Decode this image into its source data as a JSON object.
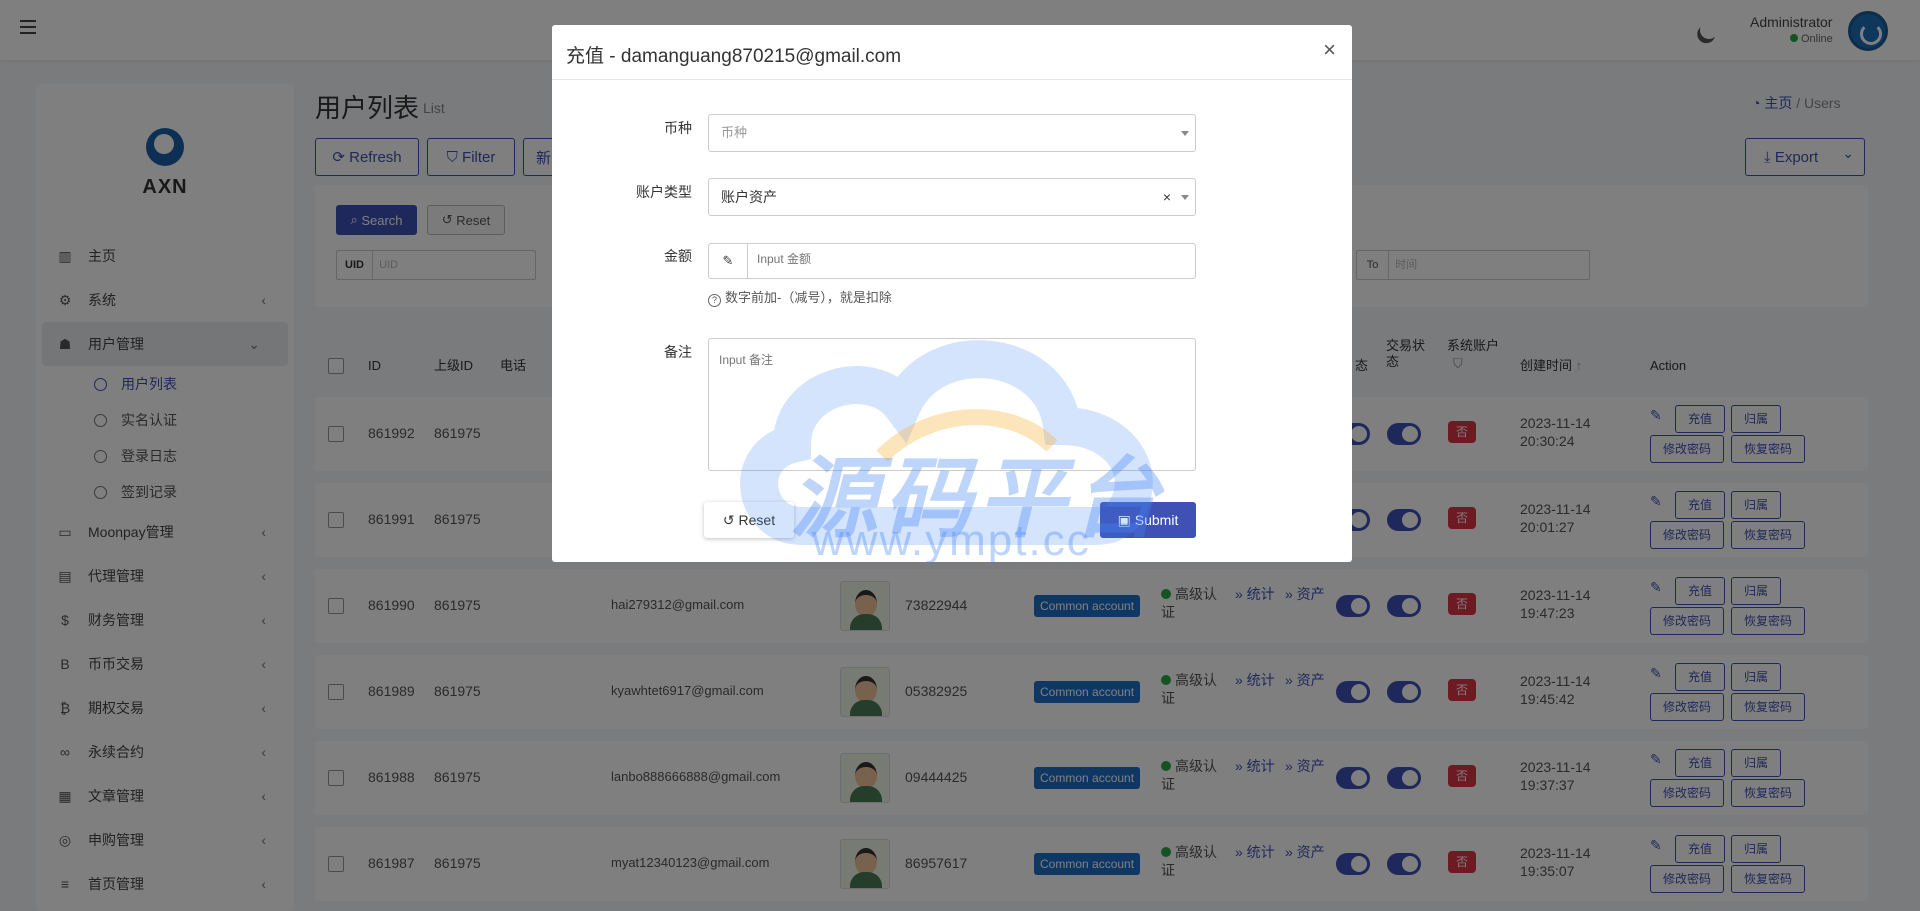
{
  "app": {
    "brand": "AXN",
    "user_name": "Administrator",
    "user_status": "Online"
  },
  "sidebar": {
    "items": [
      {
        "label": "主页",
        "icon": "bar-chart-icon"
      },
      {
        "label": "系统",
        "icon": "gear-icon"
      },
      {
        "label": "用户管理",
        "icon": "users-icon"
      },
      {
        "label": "Moonpay管理",
        "icon": "credit-card-icon"
      },
      {
        "label": "代理管理",
        "icon": "id-card-icon"
      },
      {
        "label": "财务管理",
        "icon": "dollar-icon"
      },
      {
        "label": "币币交易",
        "icon": "bitcoin-b-icon"
      },
      {
        "label": "期权交易",
        "icon": "bitcoin-icon"
      },
      {
        "label": "永续合约",
        "icon": "link-icon"
      },
      {
        "label": "文章管理",
        "icon": "newspaper-icon"
      },
      {
        "label": "申购管理",
        "icon": "life-ring-icon"
      },
      {
        "label": "首页管理",
        "icon": "list-icon"
      }
    ],
    "sub_items": [
      "用户列表",
      "实名认证",
      "登录日志",
      "签到记录"
    ]
  },
  "page": {
    "title": "用户列表",
    "subtitle": "List",
    "breadcrumb_home": "主页",
    "breadcrumb_sep": "/",
    "breadcrumb_current": "Users"
  },
  "toolbar": {
    "refresh": "Refresh",
    "filter": "Filter",
    "new": "新",
    "export": "Export",
    "search": "Search",
    "reset": "Reset"
  },
  "filters": {
    "uid_label": "UID",
    "uid_placeholder": "UID",
    "to_label": "To",
    "to_placeholder": "时间"
  },
  "table": {
    "headers": {
      "id": "ID",
      "parent_id": "上级ID",
      "phone": "电话",
      "status_tail": "态",
      "trade_status": "交易状态",
      "system_account": "系统账户",
      "created": "创建时间",
      "action": "Action"
    },
    "rows": [
      {
        "id": "861992",
        "parent": "861975",
        "email": "",
        "phone": "",
        "created_date": "2023-11-14",
        "created_time": "20:30:24",
        "sys": "否"
      },
      {
        "id": "861991",
        "parent": "861975",
        "email": "",
        "phone": "",
        "created_date": "2023-11-14",
        "created_time": "20:01:27",
        "sys": "否"
      },
      {
        "id": "861990",
        "parent": "861975",
        "email": "hai279312@gmail.com",
        "phone": "73822944",
        "account": "Common account",
        "auth": "高级认证",
        "stats": "» 统计",
        "assets": "» 资产",
        "created_date": "2023-11-14",
        "created_time": "19:47:23",
        "sys": "否"
      },
      {
        "id": "861989",
        "parent": "861975",
        "email": "kyawhtet6917@gmail.com",
        "phone": "05382925",
        "account": "Common account",
        "auth": "高级认证",
        "stats": "» 统计",
        "assets": "» 资产",
        "created_date": "2023-11-14",
        "created_time": "19:45:42",
        "sys": "否"
      },
      {
        "id": "861988",
        "parent": "861975",
        "email": "lanbo888666888@gmail.com",
        "phone": "09444425",
        "account": "Common account",
        "auth": "高级认证",
        "stats": "» 统计",
        "assets": "» 资产",
        "created_date": "2023-11-14",
        "created_time": "19:37:37",
        "sys": "否"
      },
      {
        "id": "861987",
        "parent": "861975",
        "email": "myat12340123@gmail.com",
        "phone": "86957617",
        "account": "Common account",
        "auth": "高级认证",
        "stats": "» 统计",
        "assets": "» 资产",
        "created_date": "2023-11-14",
        "created_time": "19:35:07",
        "sys": "否"
      }
    ],
    "actions": {
      "recharge": "充值",
      "belong": "归属",
      "edit_pwd": "修改密码",
      "restore_pwd": "恢复密码"
    }
  },
  "modal": {
    "title": "充值 - damanguang870215@gmail.com",
    "close": "×",
    "currency_label": "币种",
    "currency_placeholder": "币种",
    "account_type_label": "账户类型",
    "account_type_value": "账户资产",
    "account_type_clear": "×",
    "amount_label": "金额",
    "amount_placeholder": "Input 金额",
    "amount_help": "数字前加-（减号），就是扣除",
    "remark_label": "备注",
    "remark_placeholder": "Input 备注",
    "reset": "Reset",
    "submit": "Submit"
  },
  "watermark": {
    "text": "源码平台",
    "url": "www.ympt.cc"
  },
  "colors": {
    "primary": "#3f51b5",
    "danger": "#dc3545",
    "success": "#28a745",
    "account_badge": "#1e6fc9"
  }
}
